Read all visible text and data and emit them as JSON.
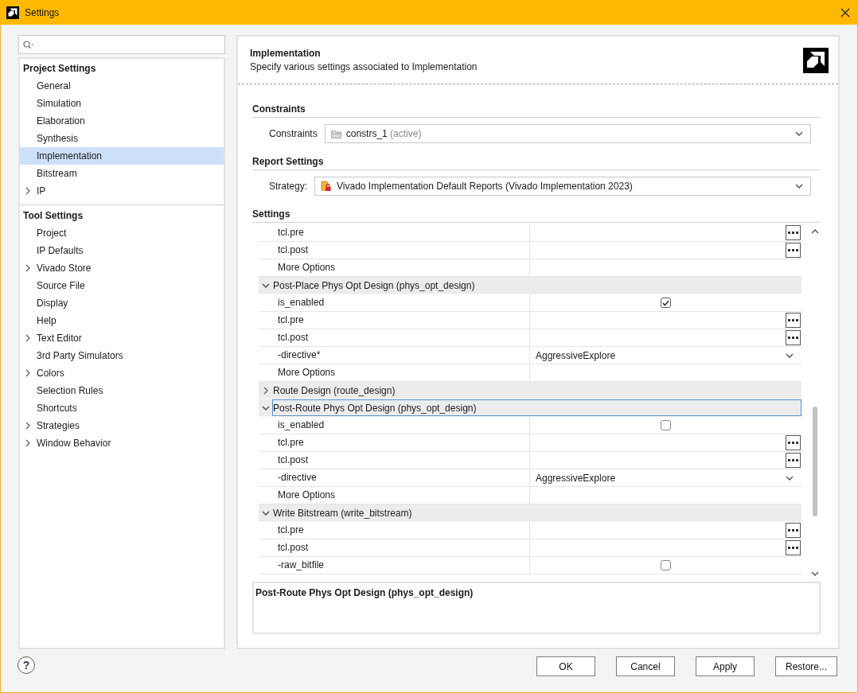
{
  "window": {
    "title": "Settings"
  },
  "sidebar": {
    "sections": [
      {
        "title": "Project Settings",
        "items": [
          {
            "label": "General",
            "selected": false,
            "expandable": false
          },
          {
            "label": "Simulation",
            "selected": false,
            "expandable": false
          },
          {
            "label": "Elaboration",
            "selected": false,
            "expandable": false
          },
          {
            "label": "Synthesis",
            "selected": false,
            "expandable": false
          },
          {
            "label": "Implementation",
            "selected": true,
            "expandable": false
          },
          {
            "label": "Bitstream",
            "selected": false,
            "expandable": false
          },
          {
            "label": "IP",
            "selected": false,
            "expandable": true
          }
        ]
      },
      {
        "title": "Tool Settings",
        "items": [
          {
            "label": "Project",
            "selected": false,
            "expandable": false
          },
          {
            "label": "IP Defaults",
            "selected": false,
            "expandable": false
          },
          {
            "label": "Vivado Store",
            "selected": false,
            "expandable": true
          },
          {
            "label": "Source File",
            "selected": false,
            "expandable": false
          },
          {
            "label": "Display",
            "selected": false,
            "expandable": false
          },
          {
            "label": "Help",
            "selected": false,
            "expandable": false
          },
          {
            "label": "Text Editor",
            "selected": false,
            "expandable": true
          },
          {
            "label": "3rd Party Simulators",
            "selected": false,
            "expandable": false
          },
          {
            "label": "Colors",
            "selected": false,
            "expandable": true
          },
          {
            "label": "Selection Rules",
            "selected": false,
            "expandable": false
          },
          {
            "label": "Shortcuts",
            "selected": false,
            "expandable": false
          },
          {
            "label": "Strategies",
            "selected": false,
            "expandable": true
          },
          {
            "label": "Window Behavior",
            "selected": false,
            "expandable": true
          }
        ]
      }
    ]
  },
  "panel": {
    "title": "Implementation",
    "description": "Specify various settings associated to Implementation",
    "constraints": {
      "heading": "Constraints",
      "label": "Constraints",
      "value": "constrs_1",
      "status": "(active)"
    },
    "report_settings": {
      "heading": "Report Settings",
      "label": "Strategy:",
      "value": "Vivado Implementation Default Reports (Vivado Implementation 2023)"
    },
    "settings": {
      "heading": "Settings",
      "rows": [
        {
          "kind": "browse",
          "name": "tcl.pre"
        },
        {
          "kind": "browse",
          "name": "tcl.post"
        },
        {
          "kind": "blank",
          "name": "More Options"
        },
        {
          "kind": "group",
          "label": "Post-Place Phys Opt Design (phys_opt_design)",
          "expanded": true,
          "selected": false,
          "children": [
            {
              "kind": "checkbox",
              "name": "is_enabled",
              "checked": true
            },
            {
              "kind": "browse",
              "name": "tcl.pre"
            },
            {
              "kind": "browse",
              "name": "tcl.post"
            },
            {
              "kind": "dropdown",
              "name": "-directive*",
              "value": "AggressiveExplore"
            },
            {
              "kind": "blank",
              "name": "More Options"
            }
          ]
        },
        {
          "kind": "group",
          "label": "Route Design (route_design)",
          "expanded": false,
          "selected": false
        },
        {
          "kind": "group",
          "label": "Post-Route Phys Opt Design (phys_opt_design)",
          "expanded": true,
          "selected": true,
          "children": [
            {
              "kind": "checkbox",
              "name": "is_enabled",
              "checked": false
            },
            {
              "kind": "browse",
              "name": "tcl.pre"
            },
            {
              "kind": "browse",
              "name": "tcl.post"
            },
            {
              "kind": "dropdown",
              "name": "-directive",
              "value": "AggressiveExplore"
            },
            {
              "kind": "blank",
              "name": "More Options"
            }
          ]
        },
        {
          "kind": "group",
          "label": "Write Bitstream (write_bitstream)",
          "expanded": true,
          "selected": false,
          "children": [
            {
              "kind": "browse",
              "name": "tcl.pre"
            },
            {
              "kind": "browse",
              "name": "tcl.post"
            },
            {
              "kind": "checkbox",
              "name": "-raw_bitfile",
              "checked": false
            }
          ]
        }
      ]
    },
    "details": {
      "text": "Post-Route Phys Opt Design (phys_opt_design)"
    }
  },
  "help": {
    "label": "?"
  },
  "buttons": [
    {
      "label": "OK"
    },
    {
      "label": "Cancel"
    },
    {
      "label": "Apply"
    },
    {
      "label": "Restore..."
    }
  ]
}
